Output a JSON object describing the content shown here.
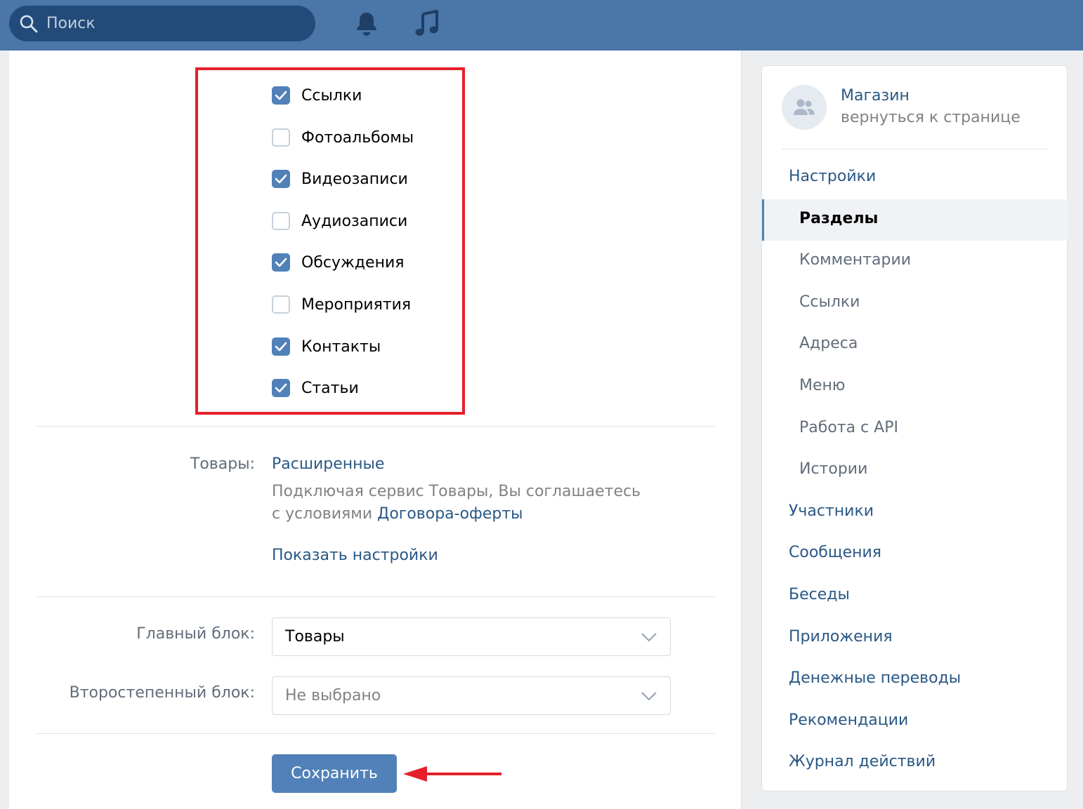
{
  "header": {
    "search_placeholder": "Поиск"
  },
  "sections": [
    {
      "label": "Ссылки",
      "checked": true
    },
    {
      "label": "Фотоальбомы",
      "checked": false
    },
    {
      "label": "Видеозаписи",
      "checked": true
    },
    {
      "label": "Аудиозаписи",
      "checked": false
    },
    {
      "label": "Обсуждения",
      "checked": true
    },
    {
      "label": "Мероприятия",
      "checked": false
    },
    {
      "label": "Контакты",
      "checked": true
    },
    {
      "label": "Статьи",
      "checked": true
    }
  ],
  "goods": {
    "label": "Товары:",
    "value": "Расширенные",
    "note_line1": "Подключая сервис Товары, Вы соглашаетесь",
    "note_line2_prefix": "с условиями",
    "note_link": "Договора-оферты",
    "show_settings": "Показать настройки"
  },
  "blocks": {
    "main_label": "Главный блок:",
    "main_value": "Товары",
    "secondary_label": "Второстепенный блок:",
    "secondary_value": "Не выбрано"
  },
  "save_label": "Сохранить",
  "sidebar": {
    "group_name": "Магазин",
    "back_link": "вернуться к странице",
    "nav": [
      {
        "label": "Настройки",
        "level": "main"
      },
      {
        "label": "Разделы",
        "level": "sub",
        "active": true
      },
      {
        "label": "Комментарии",
        "level": "sub"
      },
      {
        "label": "Ссылки",
        "level": "sub"
      },
      {
        "label": "Адреса",
        "level": "sub"
      },
      {
        "label": "Меню",
        "level": "sub"
      },
      {
        "label": "Работа с API",
        "level": "sub"
      },
      {
        "label": "Истории",
        "level": "sub"
      },
      {
        "label": "Участники",
        "level": "main"
      },
      {
        "label": "Сообщения",
        "level": "main"
      },
      {
        "label": "Беседы",
        "level": "main"
      },
      {
        "label": "Приложения",
        "level": "main"
      },
      {
        "label": "Денежные переводы",
        "level": "main"
      },
      {
        "label": "Рекомендации",
        "level": "main"
      },
      {
        "label": "Журнал действий",
        "level": "main"
      }
    ]
  },
  "colors": {
    "header_bg": "#4a76a8",
    "accent": "#5181b8",
    "link": "#2a5885",
    "highlight": "#e5202a"
  }
}
